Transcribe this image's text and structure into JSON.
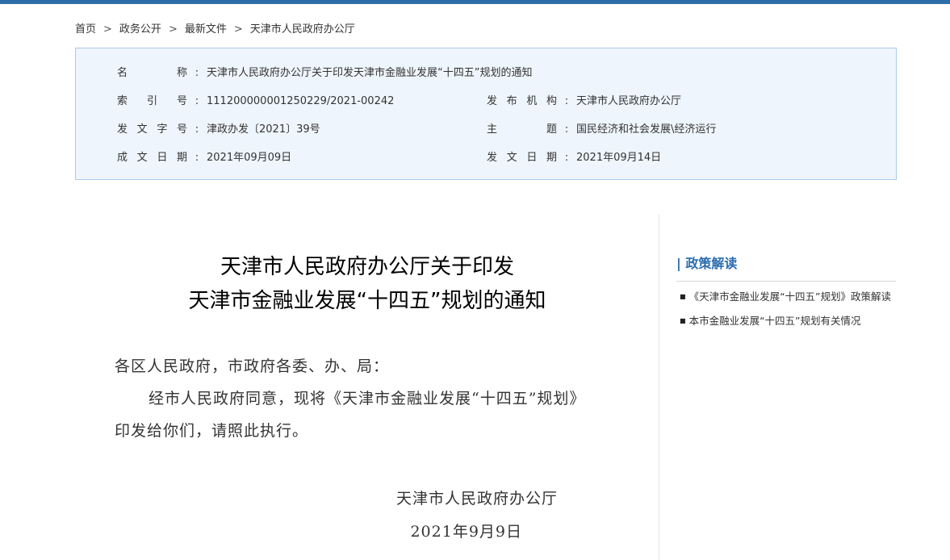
{
  "breadcrumb": {
    "items": [
      "首页",
      "政务公开",
      "最新文件",
      "天津市人民政府办公厅"
    ],
    "separator": ">"
  },
  "info": {
    "name_label": "名称",
    "name_value": "天津市人民政府办公厅关于印发天津市金融业发展“十四五”规划的通知",
    "index_label": "索引号",
    "index_value": "111200000001250229/2021-00242",
    "publisher_label": "发布机构",
    "publisher_value": "天津市人民政府办公厅",
    "doc_no_label": "发文字号",
    "doc_no_value": "津政办发〔2021〕39号",
    "topic_label": "主题",
    "topic_value": "国民经济和社会发展\\经济运行",
    "created_label": "成文日期",
    "created_value": "2021年09月09日",
    "issued_label": "发文日期",
    "issued_value": "2021年09月14日",
    "colon": ":"
  },
  "document": {
    "title_line1": "天津市人民政府办公厅关于印发",
    "title_line2": "天津市金融业发展“十四五”规划的通知",
    "greeting": "各区人民政府，市政府各委、办、局：",
    "paragraph": "经市人民政府同意，现将《天津市金融业发展“十四五”规划》印发给你们，请照此执行。",
    "signature_org": "天津市人民政府办公厅",
    "signature_date": "2021年9月9日"
  },
  "sidebar": {
    "title": "| 政策解读",
    "bullet": "■",
    "links": [
      "《天津市金融业发展“十四五”规划》政策解读",
      "本市金融业发展“十四五”规划有关情况"
    ]
  },
  "colors": {
    "accent": "#2c6db0",
    "top_bar": "#2e6ea8",
    "info_bg": "#eef5fc",
    "info_border": "#a9cbe8"
  }
}
